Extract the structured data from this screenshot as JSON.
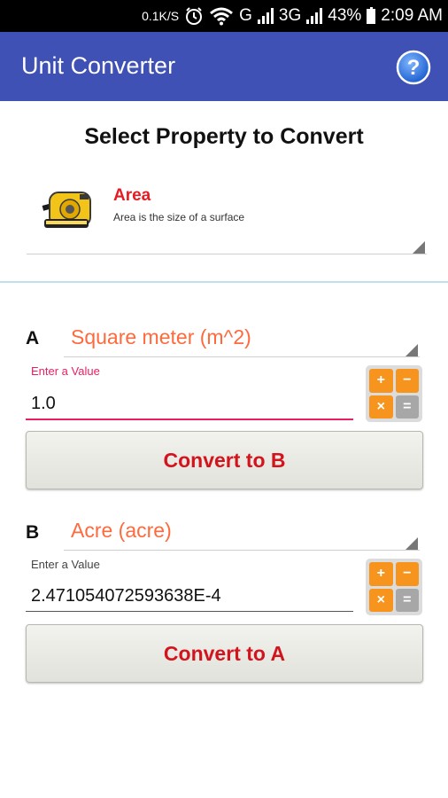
{
  "status_bar": {
    "speed": "0.1K/S",
    "network_g": "G",
    "network_3g": "3G",
    "battery": "43%",
    "time": "2:09 AM"
  },
  "app_bar": {
    "title": "Unit Converter",
    "help_icon": "help-circle-icon",
    "help_glyph": "?",
    "color": "#3f51b5"
  },
  "section_title": "Select Property to Convert",
  "property": {
    "name": "Area",
    "description": "Area is the size of a surface",
    "icon": "tape-measure-icon"
  },
  "unit_a": {
    "letter": "A",
    "unit": "Square meter (m^2)",
    "label": "Enter a Value",
    "value": "1.0",
    "convert_label": "Convert to B"
  },
  "unit_b": {
    "letter": "B",
    "unit": "Acre (acre)",
    "label": "Enter a Value",
    "value": "2.471054072593638E-4",
    "convert_label": "Convert to A"
  },
  "calculator": {
    "icon": "calculator-icon",
    "keys": [
      "+",
      "−",
      "×",
      "="
    ]
  },
  "colors": {
    "accent_red": "#e51c23",
    "unit_orange": "#ff6a3d",
    "focus_pink": "#e91e63",
    "button_text": "#d3141c"
  }
}
